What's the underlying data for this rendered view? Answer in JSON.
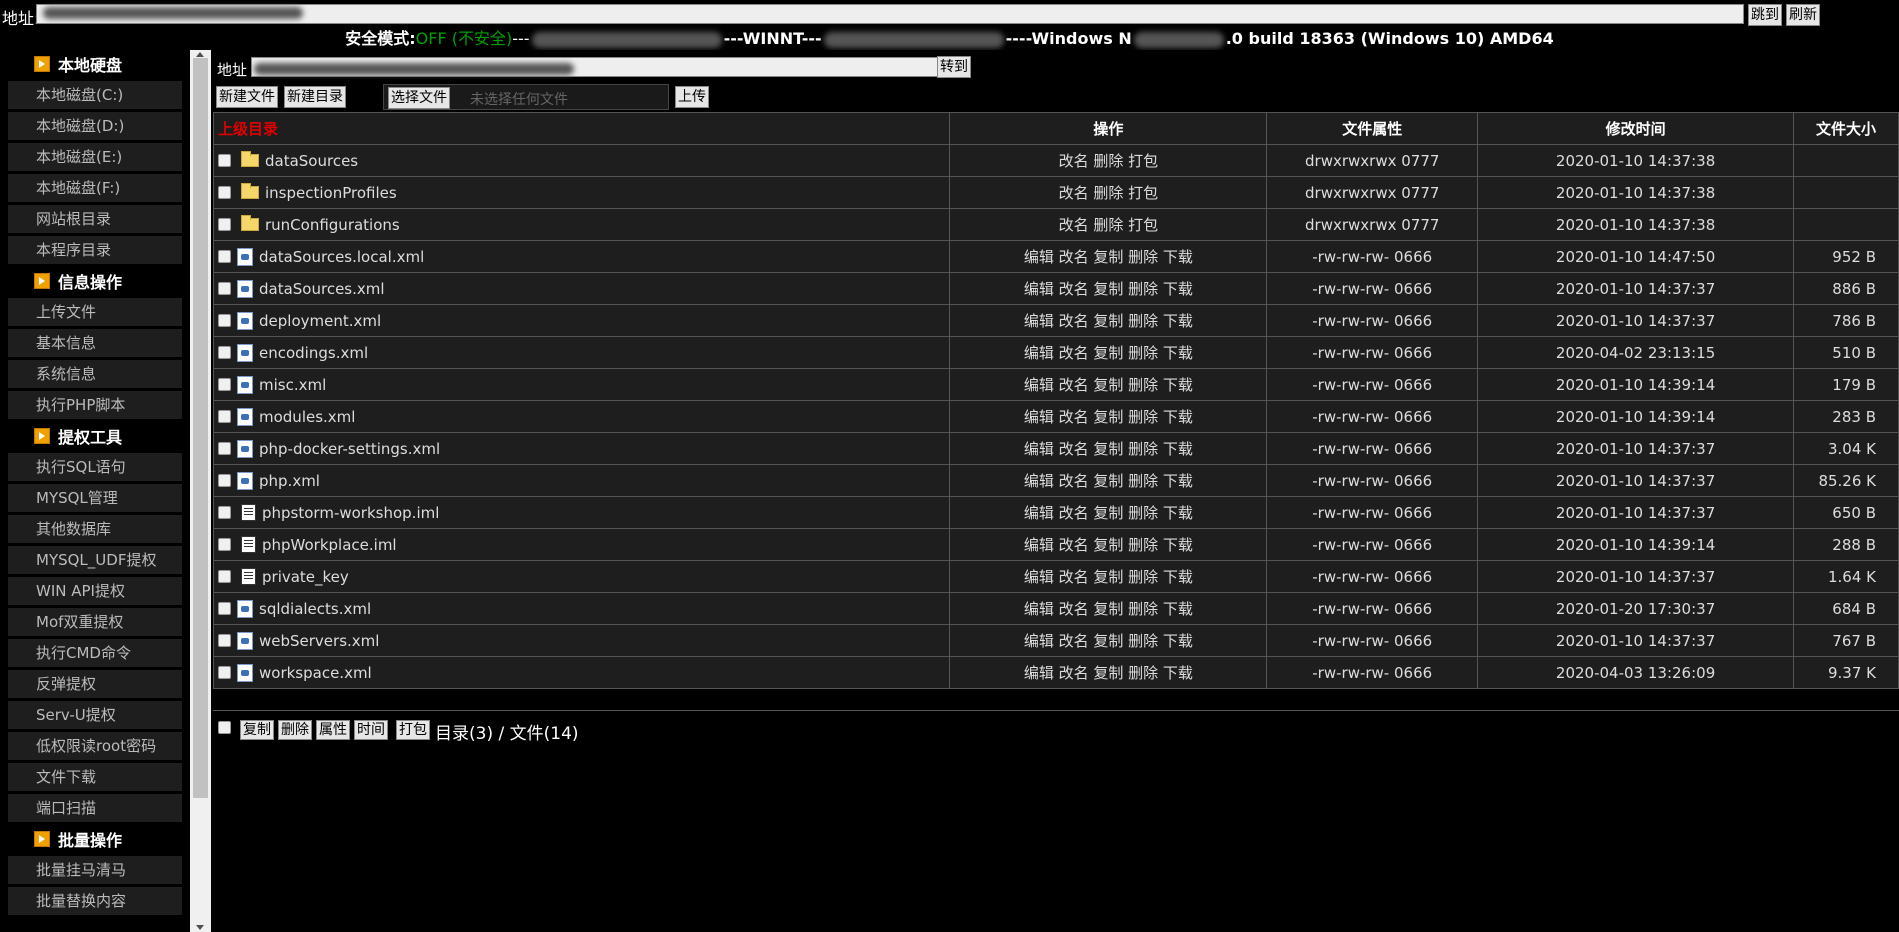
{
  "topbar": {
    "addr_label": "地址:",
    "jump_label": "跳到",
    "refresh_label": "刷新"
  },
  "status": {
    "safe_mode_label": "安全模式:",
    "safe_mode_value": "OFF (不安全)",
    "sep1": "---",
    "os_mid": "---WINNT---",
    "os_prefix": "----Windows N",
    "os_suffix": ".0 build 18363 (Windows 10) AMD64"
  },
  "sidebar": {
    "groups": [
      {
        "title": "本地硬盘",
        "items": [
          "本地磁盘(C:)",
          "本地磁盘(D:)",
          "本地磁盘(E:)",
          "本地磁盘(F:)",
          "网站根目录",
          "本程序目录"
        ]
      },
      {
        "title": "信息操作",
        "items": [
          "上传文件",
          "基本信息",
          "系统信息",
          "执行PHP脚本"
        ]
      },
      {
        "title": "提权工具",
        "items": [
          "执行SQL语句",
          "MYSQL管理",
          "其他数据库",
          "MYSQL_UDF提权",
          "WIN API提权",
          "Mof双重提权",
          "执行CMD命令",
          "反弹提权",
          "Serv-U提权",
          "低权限读root密码",
          "文件下载",
          "端口扫描"
        ]
      },
      {
        "title": "批量操作",
        "items": [
          "批量挂马清马",
          "批量替换内容"
        ]
      }
    ]
  },
  "main": {
    "addr_label": "地址",
    "goto_label": "转到",
    "new_file_label": "新建文件",
    "new_dir_label": "新建目录",
    "choose_file_label": "选择文件",
    "no_file_label": "未选择任何文件",
    "upload_label": "上传"
  },
  "table": {
    "headers": {
      "parent": "上级目录",
      "ops": "操作",
      "attr": "文件属性",
      "time": "修改时间",
      "size": "文件大小"
    },
    "rows": [
      {
        "type": "folder",
        "name": "dataSources",
        "ops": "改名 删除 打包",
        "attr": "drwxrwxrwx 0777",
        "time": "2020-01-10 14:37:38",
        "size": ""
      },
      {
        "type": "folder",
        "name": "inspectionProfiles",
        "ops": "改名 删除 打包",
        "attr": "drwxrwxrwx 0777",
        "time": "2020-01-10 14:37:38",
        "size": ""
      },
      {
        "type": "folder",
        "name": "runConfigurations",
        "ops": "改名 删除 打包",
        "attr": "drwxrwxrwx 0777",
        "time": "2020-01-10 14:37:38",
        "size": ""
      },
      {
        "type": "xml",
        "name": "dataSources.local.xml",
        "ops": "编辑 改名 复制 删除 下载",
        "attr": "-rw-rw-rw- 0666",
        "time": "2020-01-10 14:47:50",
        "size": "952 B"
      },
      {
        "type": "xml",
        "name": "dataSources.xml",
        "ops": "编辑 改名 复制 删除 下载",
        "attr": "-rw-rw-rw- 0666",
        "time": "2020-01-10 14:37:37",
        "size": "886 B"
      },
      {
        "type": "xml",
        "name": "deployment.xml",
        "ops": "编辑 改名 复制 删除 下载",
        "attr": "-rw-rw-rw- 0666",
        "time": "2020-01-10 14:37:37",
        "size": "786 B"
      },
      {
        "type": "xml",
        "name": "encodings.xml",
        "ops": "编辑 改名 复制 删除 下载",
        "attr": "-rw-rw-rw- 0666",
        "time": "2020-04-02 23:13:15",
        "size": "510 B"
      },
      {
        "type": "xml",
        "name": "misc.xml",
        "ops": "编辑 改名 复制 删除 下载",
        "attr": "-rw-rw-rw- 0666",
        "time": "2020-01-10 14:39:14",
        "size": "179 B"
      },
      {
        "type": "xml",
        "name": "modules.xml",
        "ops": "编辑 改名 复制 删除 下载",
        "attr": "-rw-rw-rw- 0666",
        "time": "2020-01-10 14:39:14",
        "size": "283 B"
      },
      {
        "type": "xml",
        "name": "php-docker-settings.xml",
        "ops": "编辑 改名 复制 删除 下载",
        "attr": "-rw-rw-rw- 0666",
        "time": "2020-01-10 14:37:37",
        "size": "3.04 K"
      },
      {
        "type": "xml",
        "name": "php.xml",
        "ops": "编辑 改名 复制 删除 下载",
        "attr": "-rw-rw-rw- 0666",
        "time": "2020-01-10 14:37:37",
        "size": "85.26 K"
      },
      {
        "type": "text",
        "name": "phpstorm-workshop.iml",
        "ops": "编辑 改名 复制 删除 下载",
        "attr": "-rw-rw-rw- 0666",
        "time": "2020-01-10 14:37:37",
        "size": "650 B"
      },
      {
        "type": "text",
        "name": "phpWorkplace.iml",
        "ops": "编辑 改名 复制 删除 下载",
        "attr": "-rw-rw-rw- 0666",
        "time": "2020-01-10 14:39:14",
        "size": "288 B"
      },
      {
        "type": "text",
        "name": "private_key",
        "ops": "编辑 改名 复制 删除 下载",
        "attr": "-rw-rw-rw- 0666",
        "time": "2020-01-10 14:37:37",
        "size": "1.64 K"
      },
      {
        "type": "xml",
        "name": "sqldialects.xml",
        "ops": "编辑 改名 复制 删除 下载",
        "attr": "-rw-rw-rw- 0666",
        "time": "2020-01-20 17:30:37",
        "size": "684 B"
      },
      {
        "type": "xml",
        "name": "webServers.xml",
        "ops": "编辑 改名 复制 删除 下载",
        "attr": "-rw-rw-rw- 0666",
        "time": "2020-01-10 14:37:37",
        "size": "767 B"
      },
      {
        "type": "xml",
        "name": "workspace.xml",
        "ops": "编辑 改名 复制 删除 下载",
        "attr": "-rw-rw-rw- 0666",
        "time": "2020-04-03 13:26:09",
        "size": "9.37 K"
      }
    ]
  },
  "bottom": {
    "copy_label": "复制",
    "delete_label": "删除",
    "attr_label": "属性",
    "time_label": "时间",
    "pack_label": "打包",
    "summary": "目录(3) / 文件(14)"
  }
}
